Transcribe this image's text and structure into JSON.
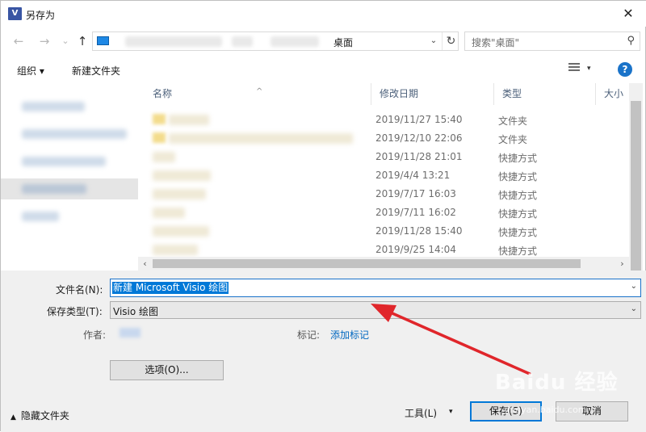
{
  "window": {
    "title": "另存为",
    "app_icon": "V",
    "close_glyph": "✕"
  },
  "navigation": {
    "back_glyph": "←",
    "forward_glyph": "→",
    "history_glyph": "⌄",
    "up_glyph": "↑",
    "address_current": "桌面",
    "address_drop_glyph": "⌄",
    "refresh_glyph": "↻",
    "search_placeholder": "搜索\"桌面\"",
    "search_glyph": "⚲"
  },
  "toolbar": {
    "organize": "组织 ▾",
    "new_folder": "新建文件夹",
    "view_drop_glyph": "▾",
    "help": "?"
  },
  "file_list": {
    "columns": {
      "name": "名称",
      "modified": "修改日期",
      "type": "类型",
      "size": "大小"
    },
    "sort_glyph": "^",
    "rows": [
      {
        "date": "2019/11/27 15:40",
        "type": "文件夹"
      },
      {
        "date": "2019/12/10 22:06",
        "type": "文件夹"
      },
      {
        "date": "2019/11/28 21:01",
        "type": "快捷方式"
      },
      {
        "date": "2019/4/4 13:21",
        "type": "快捷方式"
      },
      {
        "date": "2019/7/17 16:03",
        "type": "快捷方式"
      },
      {
        "date": "2019/7/11 16:02",
        "type": "快捷方式"
      },
      {
        "date": "2019/11/28 15:40",
        "type": "快捷方式"
      },
      {
        "date": "2019/9/25 14:04",
        "type": "快捷方式"
      }
    ],
    "scroll_left_glyph": "‹",
    "scroll_right_glyph": "›"
  },
  "form": {
    "filename_label": "文件名(N):",
    "filename_value": "新建 Microsoft Visio 绘图",
    "filetype_label": "保存类型(T):",
    "filetype_value": "Visio 绘图",
    "dropdown_glyph": "⌄",
    "author_label": "作者:",
    "tags_label": "标记:",
    "tags_link": "添加标记",
    "options_button": "选项(O)..."
  },
  "footer": {
    "hide_folders_glyph": "▲",
    "hide_folders": "隐藏文件夹",
    "tools": "工具(L)",
    "tools_drop_glyph": "▾",
    "save": "保存(S)",
    "cancel": "取消"
  },
  "watermark": {
    "main": "Baidu 经验",
    "sub": "jingyan.baidu.com"
  },
  "colors": {
    "accent": "#0078d7",
    "arrow": "#e0262b"
  }
}
